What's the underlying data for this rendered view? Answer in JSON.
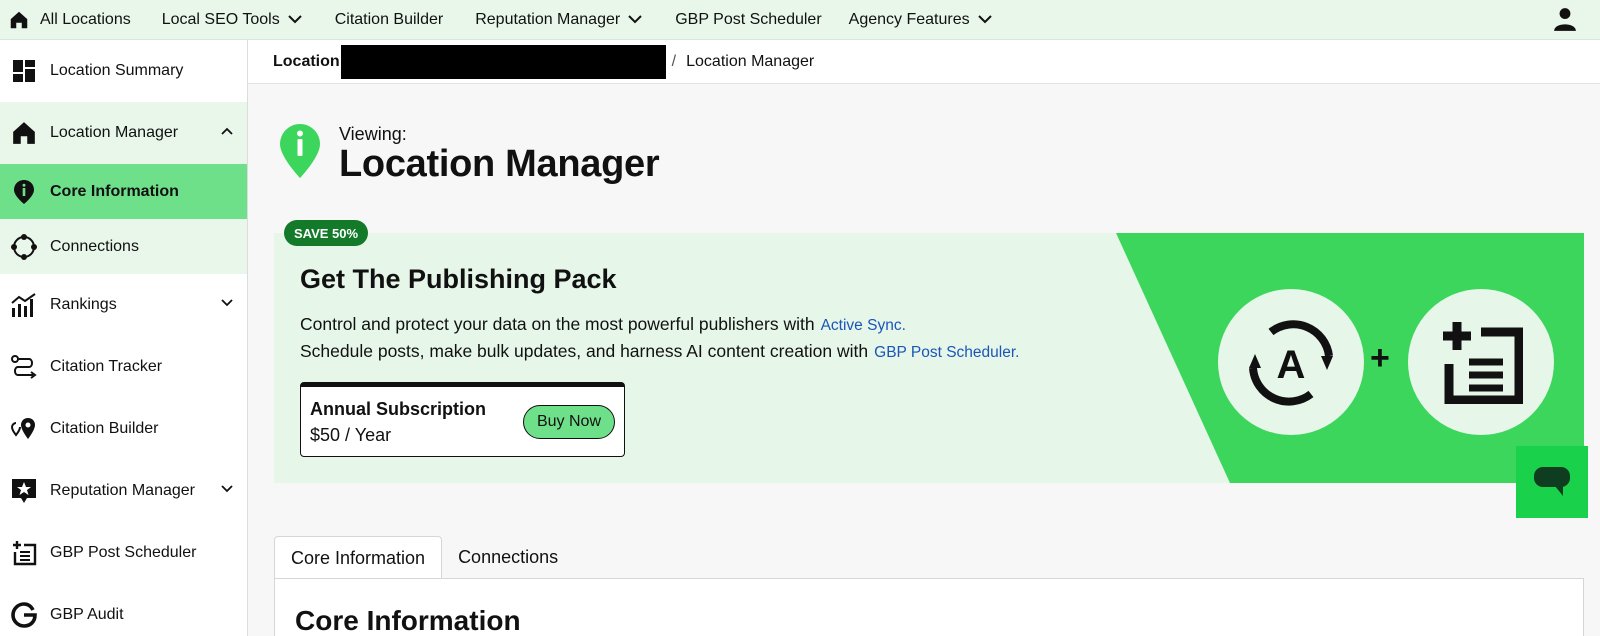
{
  "topnav": {
    "items": [
      {
        "label": "All Locations"
      },
      {
        "label": "Local SEO Tools"
      },
      {
        "label": "Citation Builder"
      },
      {
        "label": "Reputation Manager"
      },
      {
        "label": "GBP Post Scheduler"
      },
      {
        "label": "Agency Features"
      }
    ]
  },
  "sidebar": {
    "items": [
      {
        "label": "Location Summary",
        "icon": "grid-icon"
      },
      {
        "label": "Location Manager",
        "icon": "house-icon"
      },
      {
        "label": "Core Information",
        "icon": "info-pin-icon"
      },
      {
        "label": "Connections",
        "icon": "connections-icon"
      },
      {
        "label": "Rankings",
        "icon": "bar-chart-icon"
      },
      {
        "label": "Citation Tracker",
        "icon": "route-icon"
      },
      {
        "label": "Citation Builder",
        "icon": "map-pin-icon"
      },
      {
        "label": "Reputation Manager",
        "icon": "star-box-icon"
      },
      {
        "label": "GBP Post Scheduler",
        "icon": "post-add-icon"
      },
      {
        "label": "GBP Audit",
        "icon": "google-g-icon"
      }
    ]
  },
  "breadcrumb": {
    "location_label": "Location",
    "separator": "/",
    "current": "Location Manager"
  },
  "header": {
    "viewing": "Viewing:",
    "title": "Location Manager"
  },
  "promo": {
    "badge": "SAVE 50%",
    "title": "Get The Publishing Pack",
    "line1": "Control and protect your data on the most powerful publishers with",
    "line1_link": "Active Sync.",
    "line2": "Schedule posts, make bulk updates, and harness AI content creation with",
    "line2_link": "GBP Post Scheduler.",
    "plan_name": "Annual Subscription",
    "plan_price": "$50 / Year",
    "buy_label": "Buy Now",
    "plus": "+"
  },
  "tabs": [
    {
      "label": "Core Information"
    },
    {
      "label": "Connections"
    }
  ],
  "panel": {
    "title": "Core Information"
  },
  "colors": {
    "accent": "#3dd65d",
    "light_green": "#e8f7ea",
    "active_green": "#6fe08a",
    "badge": "#137a2a",
    "link": "#1a55b8",
    "chat": "#1ad14b"
  }
}
